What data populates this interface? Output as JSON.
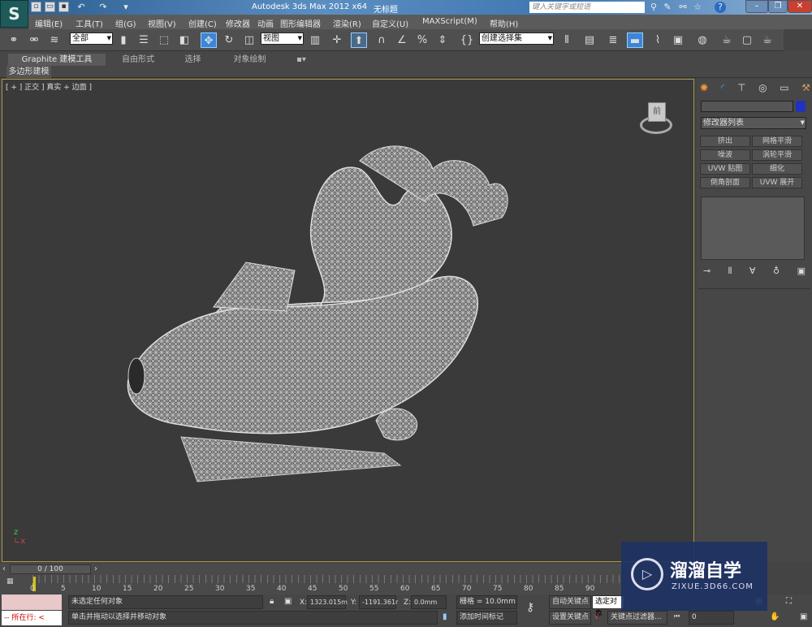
{
  "title_bar": {
    "app": "Autodesk 3ds Max  2012 x64",
    "document": "无标题",
    "search_placeholder": "键入关键字或短语",
    "logo": "S"
  },
  "menu": [
    "编辑(E)",
    "工具(T)",
    "组(G)",
    "视图(V)",
    "创建(C)",
    "修改器",
    "动画",
    "图形编辑器",
    "渲染(R)",
    "自定义(U)",
    "MAXScript(M)",
    "帮助(H)"
  ],
  "toolbar": {
    "selection_filter": "全部",
    "reference_coord": "视图",
    "named_selection": "创建选择集"
  },
  "ribbon": {
    "tabs": [
      "Graphite 建模工具",
      "自由形式",
      "选择",
      "对象绘制"
    ],
    "subtab": "多边形建模"
  },
  "viewport": {
    "label": "[ + ] 正交 ] 真实 + 边面 ]",
    "viewcube_face": "前"
  },
  "command_panel": {
    "object_color": "#2233bb",
    "modifier_list": "修改器列表",
    "buttons": [
      "挤出",
      "网格平滑",
      "噪波",
      "涡轮平滑",
      "UVW 贴图",
      "细化",
      "倒角剖面",
      "UVW 展开"
    ]
  },
  "time": {
    "frame": "0 / 100",
    "ticks": [
      "0",
      "5",
      "10",
      "15",
      "20",
      "25",
      "30",
      "35",
      "40",
      "45",
      "50",
      "55",
      "60",
      "65",
      "70",
      "75",
      "80",
      "85",
      "90"
    ]
  },
  "status": {
    "script": "-- 所在行: <",
    "selection": "未选定任何对象",
    "prompt": "单击并拖动以选择并移动对象",
    "x_label": "X:",
    "x": "1323.015m",
    "y_label": "Y:",
    "y": "-1191.361r",
    "z_label": "Z:",
    "z": "0.0mm",
    "grid": "栅格 = 10.0mm",
    "add_time_tag": "添加时间标记",
    "auto_key": "自动关键点",
    "selected": "选定对象",
    "set_key": "设置关键点",
    "key_filters": "关键点过滤器...",
    "frame_value": "0"
  },
  "watermark": {
    "name": "溜溜自学",
    "url": "ZIXUE.3D66.COM"
  }
}
